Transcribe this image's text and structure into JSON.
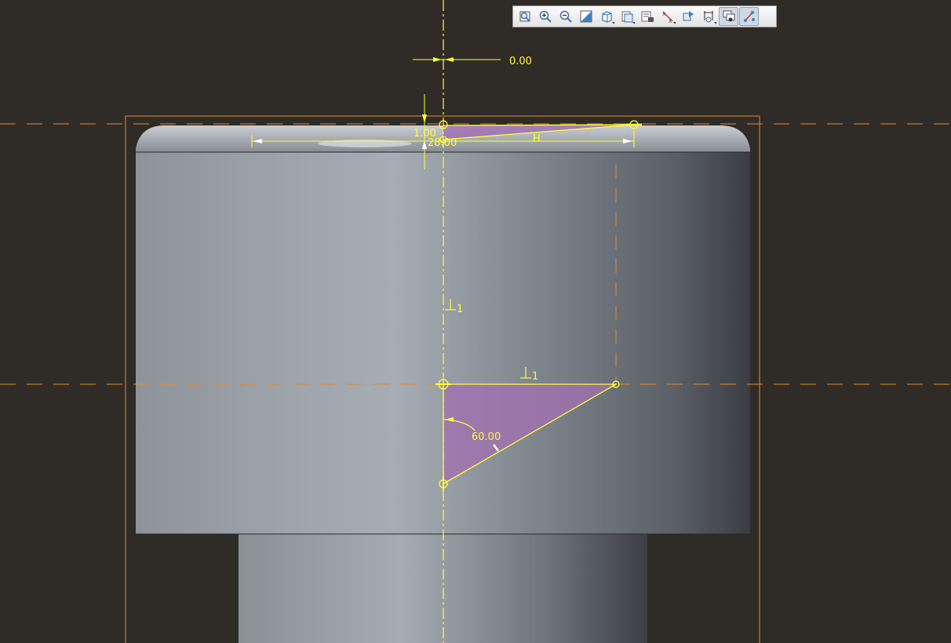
{
  "toolbar": {
    "buttons": [
      {
        "name": "refit-icon",
        "flyout": false,
        "active": false
      },
      {
        "name": "zoom-in-icon",
        "flyout": false,
        "active": false
      },
      {
        "name": "zoom-out-icon",
        "flyout": false,
        "active": false
      },
      {
        "name": "repaint-icon",
        "flyout": false,
        "active": false
      },
      {
        "name": "display-style-icon",
        "flyout": true,
        "active": false
      },
      {
        "name": "saved-orientations-icon",
        "flyout": true,
        "active": false
      },
      {
        "name": "view-manager-icon",
        "flyout": false,
        "active": false
      },
      {
        "name": "datum-display-icon",
        "flyout": true,
        "active": false
      },
      {
        "name": "annotation-display-icon",
        "flyout": false,
        "active": false
      },
      {
        "name": "sketcher-display-icon",
        "flyout": true,
        "active": false
      },
      {
        "name": "sketch-view-icon",
        "flyout": false,
        "active": true
      },
      {
        "name": "sketch-constraints-icon",
        "flyout": false,
        "active": true
      }
    ]
  },
  "dimensions": {
    "offset": "0.00",
    "height_small": "1.00",
    "diameter": "28.00",
    "variable_h": "H",
    "angle": "60.00",
    "perpendicular_label": "1"
  },
  "colors": {
    "background": "#2f2c28",
    "sketch_yellow": "#ffff33",
    "reference_orange": "#e38b2a",
    "region_fill": "#a070b0"
  }
}
